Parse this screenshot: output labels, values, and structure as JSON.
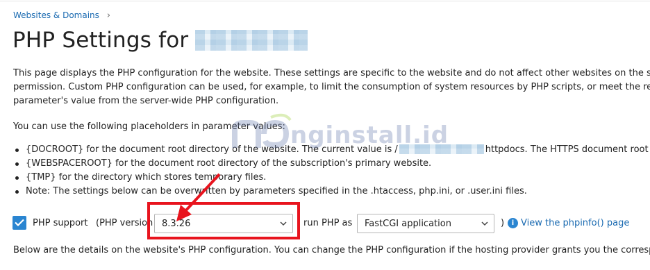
{
  "breadcrumb": {
    "label": "Websites & Domains",
    "separator": "›"
  },
  "page": {
    "title": "PHP Settings for"
  },
  "intro": {
    "line1": "This page displays the PHP configuration for the website. These settings are specific to the website and do not affect other websites on the su",
    "line2": "permission. Custom PHP configuration can be used, for example, to limit the consumption of system resources by PHP scripts, or meet the re",
    "line3": "parameter's value from the server-wide PHP configuration."
  },
  "placeholders": {
    "heading": "You can use the following placeholders in parameter values:",
    "items": [
      {
        "prefix": "{DOCROOT} for the document root directory of the website. The current value is /",
        "suffix": "httpdocs. The HTTPS document root d"
      },
      {
        "text": "{WEBSPACEROOT} for the document root directory of the subscription's primary website."
      },
      {
        "text": "{TMP} for the directory which stores temporary files."
      },
      {
        "text": "Note: The settings below can be overwritten by parameters specified in the .htaccess, php.ini, or .user.ini files."
      }
    ]
  },
  "watermark": {
    "text": "nginstall.id"
  },
  "php_support": {
    "checked": true,
    "label": "PHP support",
    "version_prefix": "(PHP version",
    "version_value": "8.3.26",
    "run_as_label": "run PHP as",
    "handler_value": "FastCGI application",
    "close_paren": ")",
    "phpinfo_link": "View the phpinfo() page"
  },
  "details": {
    "text": "Below are the details on the website's PHP configuration. You can change the PHP configuration if the hosting provider grants you the corresp"
  },
  "colors": {
    "link": "#1a6ab1",
    "accent": "#2a85d1",
    "highlight": "#e8141e"
  }
}
